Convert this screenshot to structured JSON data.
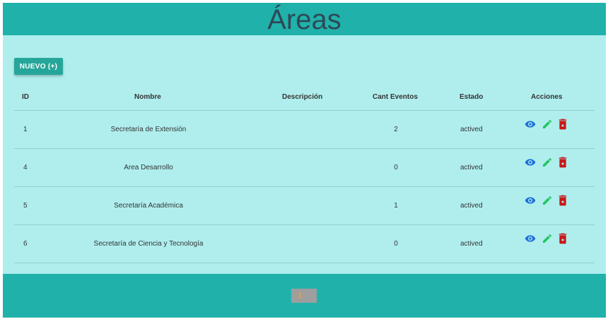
{
  "header": {
    "title": "Áreas"
  },
  "toolbar": {
    "new_label": "NUEVO (+)"
  },
  "table": {
    "columns": {
      "id": "ID",
      "nombre": "Nombre",
      "descripcion": "Descripción",
      "cant": "Cant Eventos",
      "estado": "Estado",
      "acciones": "Acciones"
    },
    "rows": [
      {
        "id": "1",
        "nombre": "Secretaría de Extensión",
        "descripcion": "",
        "cant": "2",
        "estado": "actived"
      },
      {
        "id": "4",
        "nombre": "Area Desarrollo",
        "descripcion": "",
        "cant": "0",
        "estado": "actived"
      },
      {
        "id": "5",
        "nombre": "Secretaría Académica",
        "descripcion": "",
        "cant": "1",
        "estado": "actived"
      },
      {
        "id": "6",
        "nombre": "Secretaría de Ciencia y Tecnología",
        "descripcion": "",
        "cant": "0",
        "estado": "actived"
      }
    ],
    "action_icons": [
      "eye-icon",
      "pencil-icon",
      "trash-icon"
    ]
  },
  "pagination": {
    "current_page": "1"
  },
  "colors": {
    "header_bg": "#20b2aa",
    "content_bg": "#b0eeee",
    "button_bg": "#26a69a",
    "view_icon": "#1e6fd9",
    "edit_icon": "#22c55e",
    "delete_icon": "#c81818"
  }
}
